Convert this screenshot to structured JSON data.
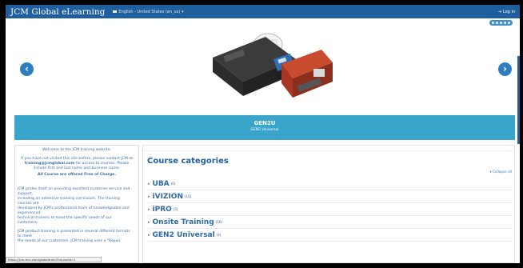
{
  "header": {
    "brand": "JCM Global eLearning",
    "language": "English - United States (en_us)",
    "login_label": "Log in"
  },
  "slideshow": {
    "banner_title": "GEN2U",
    "banner_subtitle": "GEN2 Universal",
    "dot_count": 5
  },
  "sidebar": {
    "welcome": "Welcome to the JCM training website.",
    "line1": "If you have not visited this site before, please contact JCM at",
    "email": "training@jcmglobal.com",
    "line1b": "for access to courses. Please",
    "line2": "include first and last name and business name.",
    "free": "All Course are offered Free of Charge.",
    "p2_1": "JCM prides itself on providing excellent customer service and",
    "p2_2": "support,",
    "p2_3": "including an extensive training curriculum. The training",
    "p2_4": "courses are",
    "p2_5": "developed by JCM's professional team of knowledgeable and",
    "p2_6": "experienced",
    "p2_7": "technical trainers to meet the specific needs of our",
    "p2_8": "customers.",
    "p3_1": "JCM product training is presented in several different formats",
    "p3_2": "to meet",
    "p3_3": "the needs of our customers. JCM training uses a \"Repair"
  },
  "status_url": "https://jcm.ecn.com/globaltrain/?courseId=1",
  "main": {
    "title": "Course categories",
    "collapse_label": "Collapse all",
    "categories": [
      {
        "name": "UBA",
        "count": "(6)"
      },
      {
        "name": "iVIZION",
        "count": "(10)"
      },
      {
        "name": "iPRO",
        "count": "(5)"
      },
      {
        "name": "Onsite Training",
        "count": "(10)"
      },
      {
        "name": "GEN2 Universal",
        "count": "(4)"
      }
    ]
  },
  "colors": {
    "navbar": "#1f5f9e",
    "banner": "#3aa5cb",
    "link": "#2f6aa6"
  }
}
